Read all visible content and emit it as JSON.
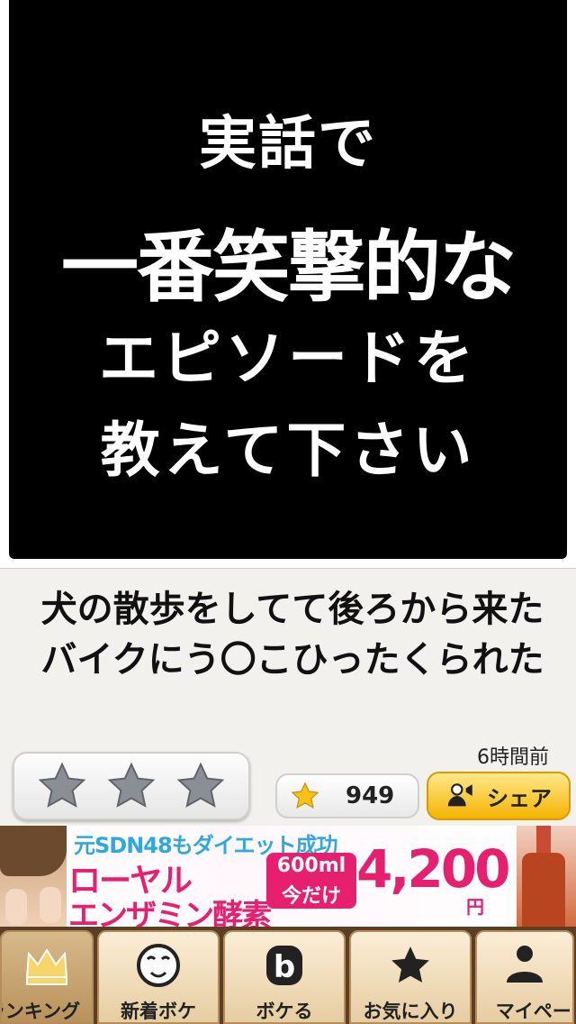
{
  "post": {
    "image_lines": [
      "実話で",
      "一番笑撃的な",
      "エピソードを",
      "教えて下さい"
    ],
    "caption": "犬の散歩をしてて後ろから来たバイクにう〇こひったくられた",
    "timestamp": "6時間前",
    "rating_stars": 3,
    "star_count": "949",
    "share_label": "シェア"
  },
  "ad": {
    "top_text": "元SDN48もダイエット成功",
    "title_line1": "ローヤル",
    "title_line2": "エンザミン酵素",
    "tag_line1": "600ml",
    "tag_line2": "今だけ",
    "price": "4,200",
    "yen": "円"
  },
  "tabs": [
    {
      "label": "ランキング",
      "icon": "crown-icon"
    },
    {
      "label": "新着ボケ",
      "icon": "face-icon"
    },
    {
      "label": "ボケる",
      "icon": "b-icon"
    },
    {
      "label": "お気に入り",
      "icon": "star-icon"
    },
    {
      "label": "マイページ",
      "icon": "person-icon"
    }
  ],
  "colors": {
    "accent_pink": "#e6206e",
    "share_yellow": "#f4b400",
    "tab_brown": "#5a3f25"
  }
}
